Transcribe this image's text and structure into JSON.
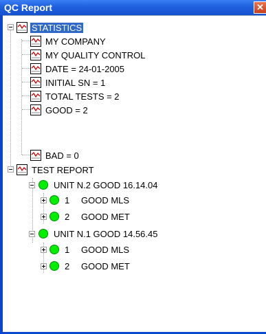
{
  "window": {
    "title": "QC Report",
    "close_glyph": "✕"
  },
  "colors": {
    "titlebar": "#1f5fe0",
    "selection": "#3169c6",
    "good_indicator": "#00ee00"
  },
  "tree": {
    "statistics": {
      "label": "STATISTICS",
      "selected": true,
      "items": [
        "MY COMPANY",
        "MY QUALITY CONTROL",
        "DATE = 24-01-2005",
        "INITIAL SN = 1",
        "TOTAL TESTS = 2",
        "GOOD = 2",
        "BAD = 0"
      ]
    },
    "test_report": {
      "label": "TEST REPORT",
      "units": [
        {
          "label": "UNIT N.2 GOOD 16.14.04",
          "tests": [
            {
              "num": "1",
              "label": "GOOD MLS"
            },
            {
              "num": "2",
              "label": "GOOD MET"
            }
          ]
        },
        {
          "label": "UNIT N.1 GOOD 14.56.45",
          "tests": [
            {
              "num": "1",
              "label": "GOOD MLS"
            },
            {
              "num": "2",
              "label": "GOOD MET"
            }
          ]
        }
      ]
    }
  }
}
